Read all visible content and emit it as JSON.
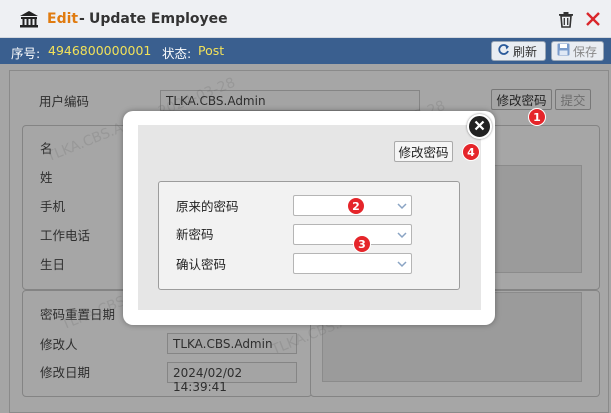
{
  "title": {
    "edit": "Edit",
    "separator": "-",
    "text": "Update Employee"
  },
  "info": {
    "seq_label": "序号:",
    "seq_value": "4946800000001",
    "status_label": "状态:",
    "status_value": "Post",
    "refresh": "刷新",
    "save": "保存"
  },
  "form": {
    "user_code_label": "用户编码",
    "user_code_value": "TLKA.CBS.Admin",
    "change_pwd": "修改密码",
    "submit": "提交",
    "first_name": "名",
    "last_name": "姓",
    "mobile": "手机",
    "work_phone": "工作电话",
    "birthday": "生日",
    "pwd_reset_date": "密码重置日期",
    "modified_by_label": "修改人",
    "modified_by_value": "TLKA.CBS.Admin",
    "modified_date_label": "修改日期",
    "modified_date_value": "2024/02/02 14:39:41"
  },
  "dialog": {
    "change_pwd": "修改密码",
    "old_pwd": "原来的密码",
    "new_pwd": "新密码",
    "confirm_pwd": "确认密码"
  },
  "markers": [
    "1",
    "2",
    "3",
    "4"
  ],
  "watermark": "TLKA.CBS.Admin 2024-03-28",
  "colors": {
    "accent_orange": "#e07b10",
    "infobar": "#3a5f8f",
    "info_value": "#f1e15a",
    "marker_red": "#e5252a"
  }
}
